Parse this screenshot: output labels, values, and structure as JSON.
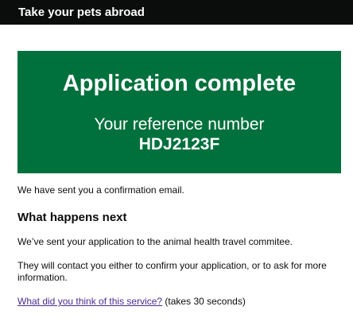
{
  "header": {
    "title": "Take your pets abroad"
  },
  "confirmation": {
    "title": "Application complete",
    "reference_label": "Your reference number",
    "reference_number": "HDJ2123F"
  },
  "main": {
    "email_notice": "We have sent you a confirmation email.",
    "next_heading": "What happens next",
    "sent_text": "We’ve sent your application to the animal health travel commitee.",
    "contact_text": "They will contact you either to confirm your application, or to ask for more information.",
    "feedback_link": "What did you think of this service?",
    "feedback_suffix": " (takes 30 seconds)"
  },
  "colors": {
    "header_bg": "#0b0c0c",
    "panel_bg": "#00703c",
    "link": "#4c2c92"
  }
}
